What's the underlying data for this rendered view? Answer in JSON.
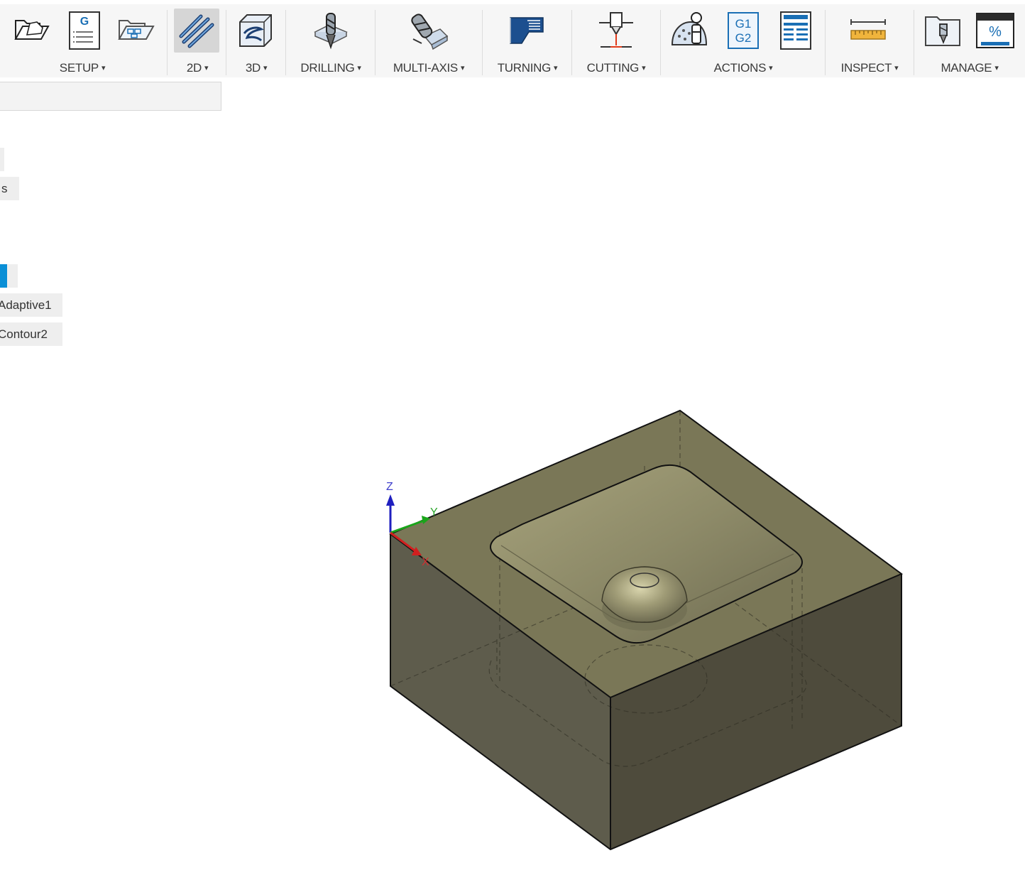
{
  "toolbar": {
    "groups": [
      {
        "id": "setup",
        "label": "SETUP",
        "tools": [
          "new-setup-icon",
          "gcode-icon",
          "folder-setup-icon"
        ]
      },
      {
        "id": "2d",
        "label": "2D",
        "tools": [
          "2d-adaptive-icon"
        ]
      },
      {
        "id": "3d",
        "label": "3D",
        "tools": [
          "3d-adaptive-icon"
        ]
      },
      {
        "id": "drilling",
        "label": "DRILLING",
        "tools": [
          "drill-icon"
        ]
      },
      {
        "id": "multi-axis",
        "label": "MULTI-AXIS",
        "tools": [
          "multi-axis-icon"
        ]
      },
      {
        "id": "turning",
        "label": "TURNING",
        "tools": [
          "turning-face-icon"
        ]
      },
      {
        "id": "cutting",
        "label": "CUTTING",
        "tools": [
          "cutting-icon"
        ]
      },
      {
        "id": "actions",
        "label": "ACTIONS",
        "tools": [
          "simulate-icon",
          "post-process-icon",
          "setup-sheet-icon"
        ]
      },
      {
        "id": "inspect",
        "label": "INSPECT",
        "tools": [
          "measure-icon"
        ]
      },
      {
        "id": "manage",
        "label": "MANAGE",
        "tools": [
          "tool-library-icon",
          "post-library-icon"
        ]
      }
    ],
    "gcode_letter": "G",
    "g1_text": "G1",
    "g2_text": "G2",
    "percent_text": "%",
    "caret": "▾"
  },
  "browser": {
    "search_value": "",
    "partial_item_s": "s",
    "operations": [
      {
        "label": "Adaptive1"
      },
      {
        "label": "Contour2"
      }
    ]
  },
  "viewport": {
    "axis_labels": {
      "z": "Z",
      "y": "Y",
      "x": "X"
    },
    "colors": {
      "top_face": "#7a7757",
      "left_face": "#5e5c4c",
      "right_face": "#4e4b3c",
      "pocket": "#8e8b66",
      "edge": "#111111",
      "axis_z": "#1f1fbf",
      "axis_y": "#1aa51a",
      "axis_x": "#d21f1f",
      "selection": "#0a8fd6"
    }
  }
}
